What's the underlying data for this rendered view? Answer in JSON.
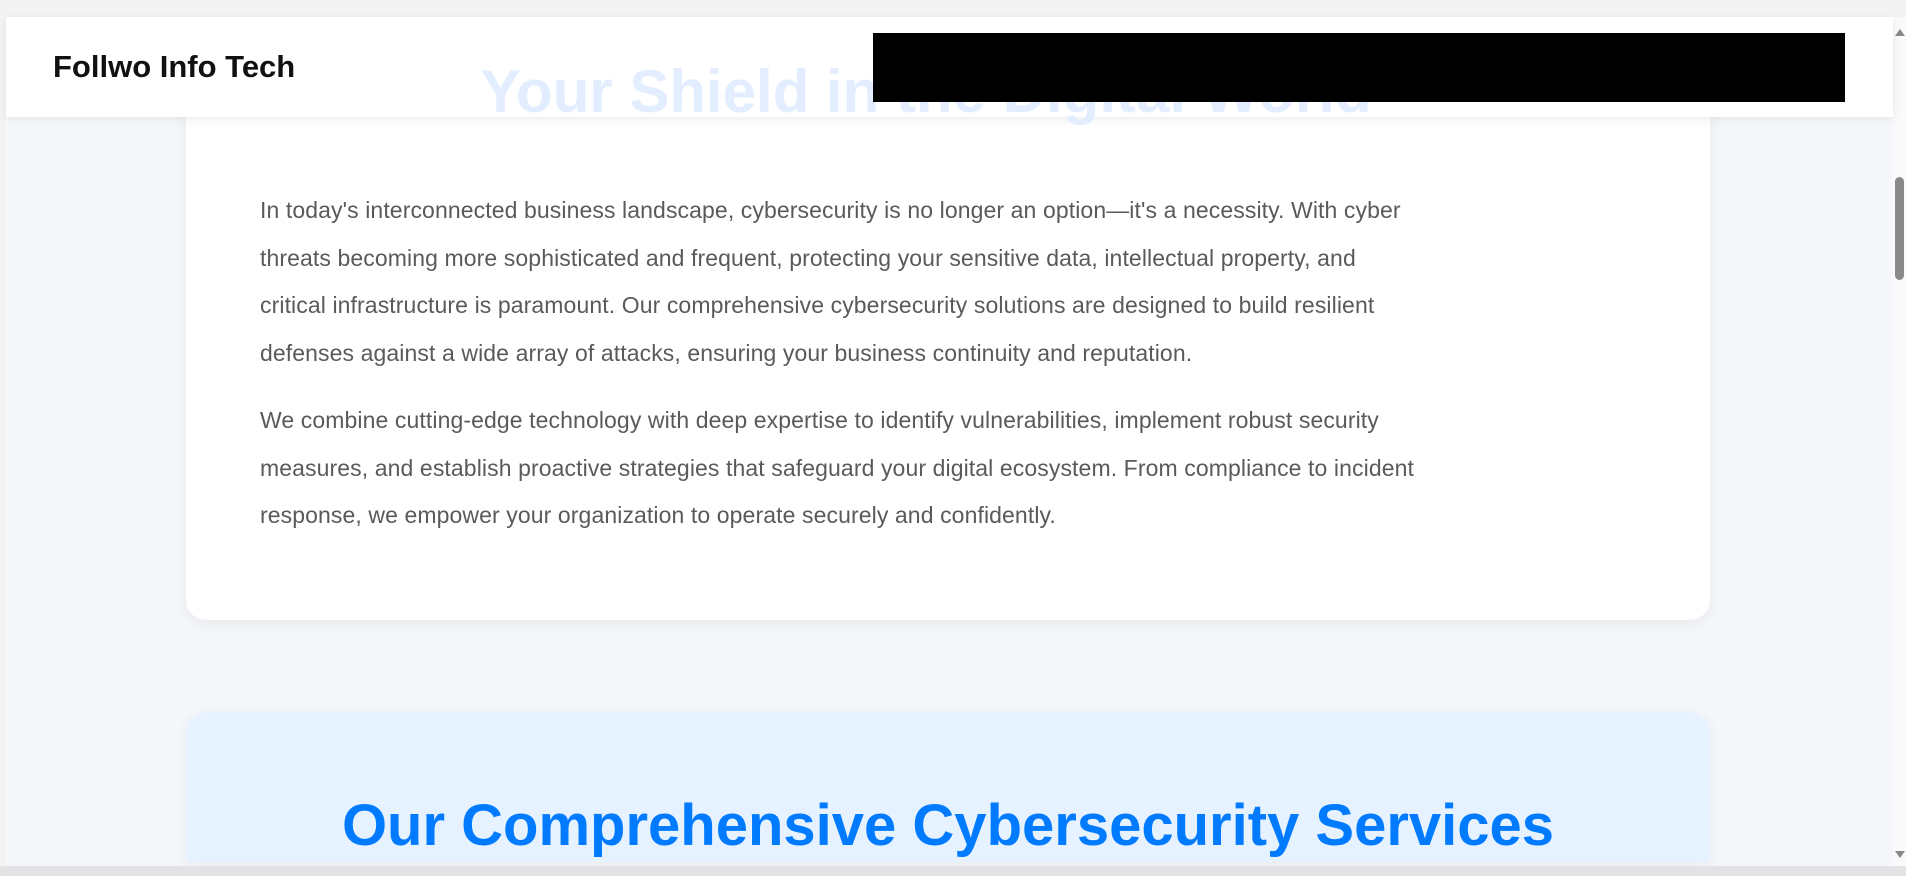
{
  "header": {
    "logo": "Follwo Info Tech"
  },
  "intro": {
    "title": "Your Shield in the Digital World",
    "paragraphs": [
      {
        "lines": [
          "In today's interconnected business landscape, cybersecurity is no longer an option—it's a necessity. With cyber",
          "threats becoming more sophisticated and frequent, protecting your sensitive data, intellectual property, and",
          "critical infrastructure is paramount. Our comprehensive cybersecurity solutions are designed to build resilient",
          "defenses against a wide array of attacks, ensuring your business continuity and reputation."
        ]
      },
      {
        "lines": [
          "We combine cutting-edge technology with deep expertise to identify vulnerabilities, implement robust security",
          "measures, and establish proactive strategies that safeguard your digital ecosystem. From compliance to incident",
          "response, we empower your organization to operate securely and confidently."
        ]
      }
    ]
  },
  "services": {
    "title": "Our Comprehensive Cybersecurity Services"
  },
  "colors": {
    "accent": "#007bff",
    "services_bg": "#e6f2ff",
    "text": "#5a5a5a"
  }
}
